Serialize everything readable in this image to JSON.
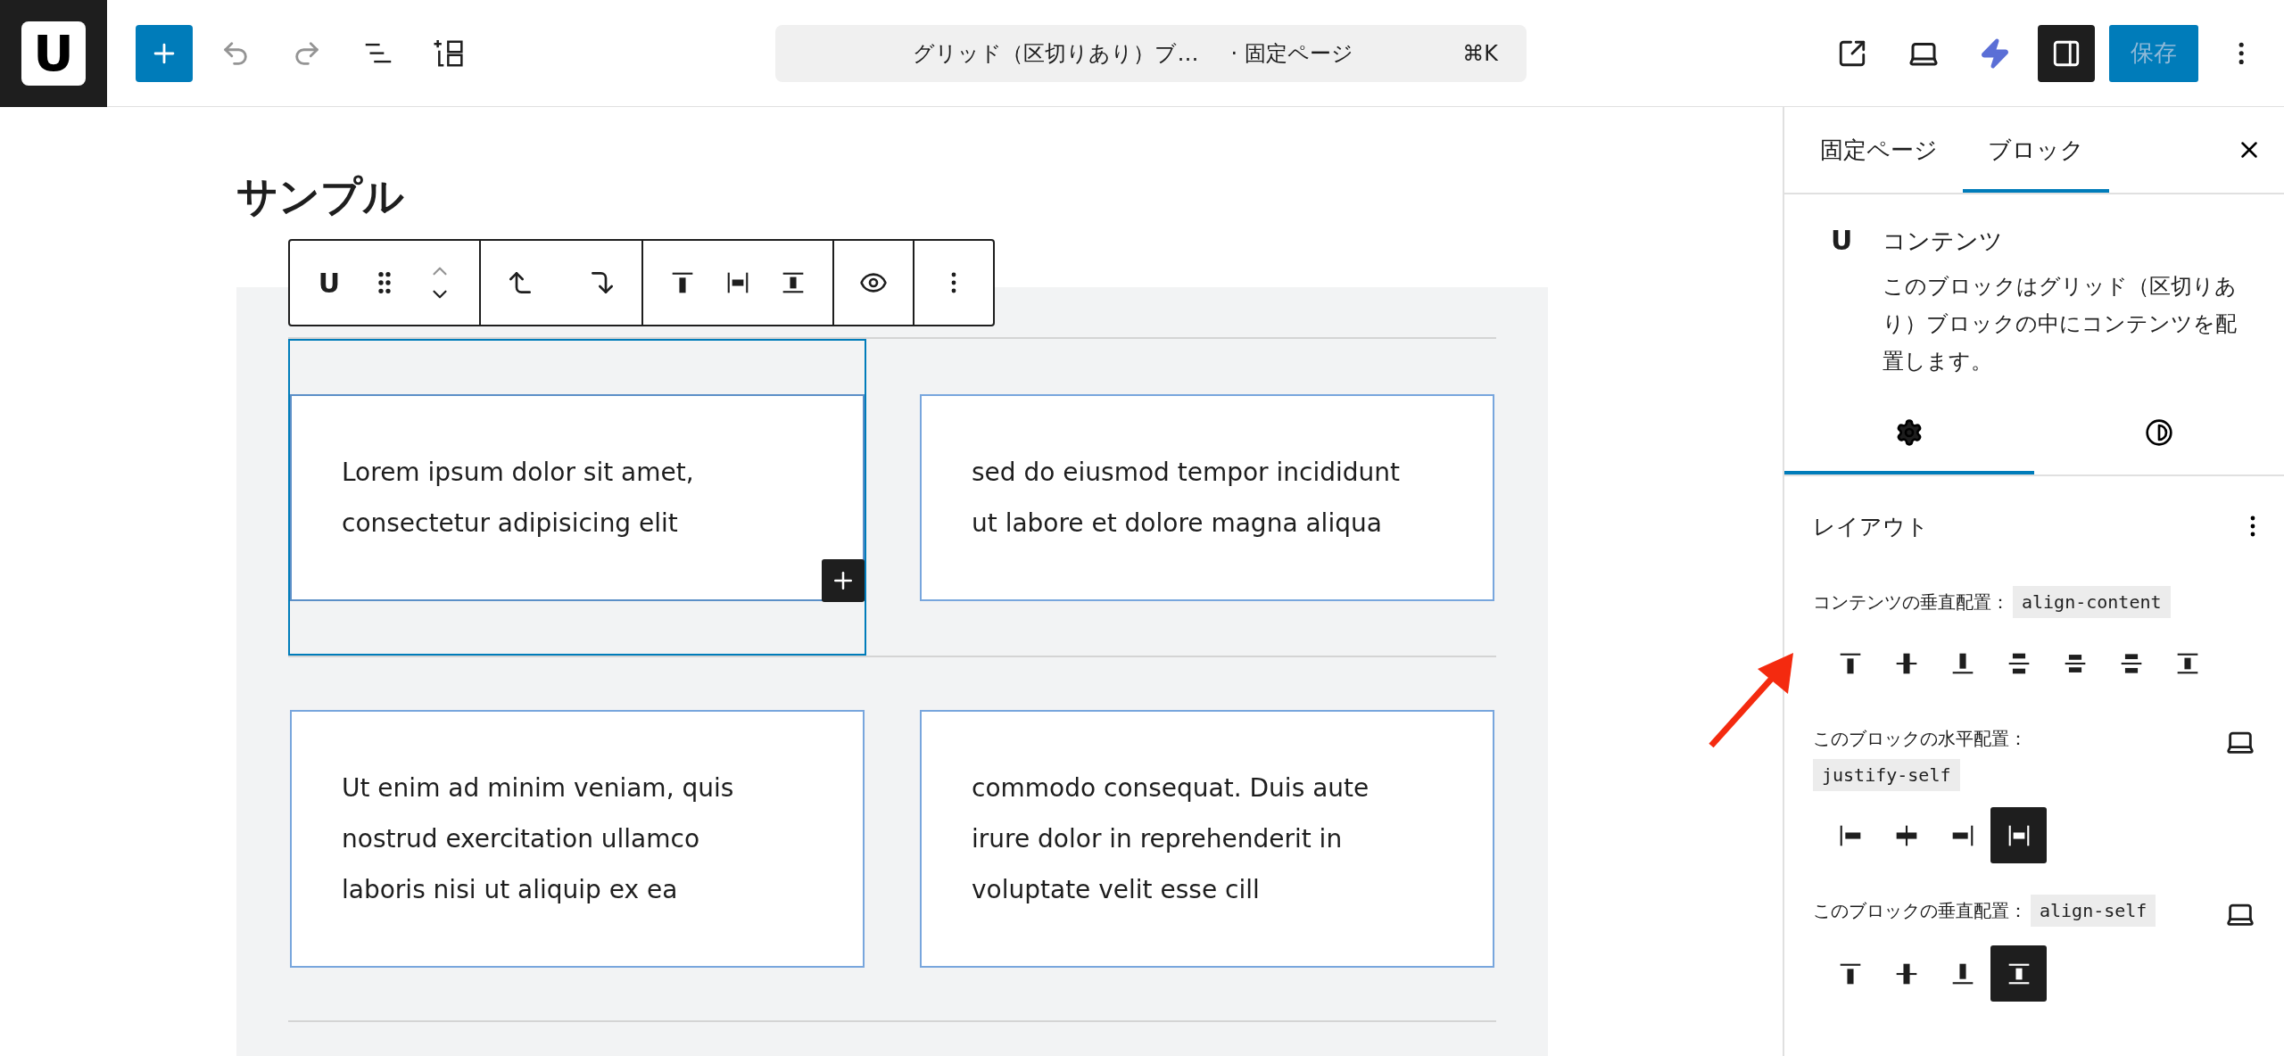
{
  "header": {
    "logo": "U",
    "undo_disabled": true,
    "redo_disabled": true,
    "command": {
      "title": "グリッド（区切りあり）ブ…",
      "type": "· 固定ページ",
      "shortcut": "⌘K"
    },
    "sidebar_open": true,
    "save": {
      "label": "保存",
      "disabled": true
    }
  },
  "canvas": {
    "title": "サンプル",
    "block_toolbar": {
      "block_icon": "U",
      "move_up_disabled": true
    },
    "cells": [
      {
        "lines": [
          "Lorem ipsum dolor sit amet,",
          "consectetur adipisicing elit"
        ],
        "selected": true
      },
      {
        "lines": [
          "sed do eiusmod tempor incididunt",
          "ut labore et dolore magna aliqua"
        ],
        "selected": false
      },
      {
        "lines": [
          "Ut enim ad minim veniam, quis",
          "nostrud exercitation ullamco",
          "laboris nisi ut aliquip ex ea"
        ],
        "selected": false
      },
      {
        "lines": [
          "commodo consequat. Duis aute",
          "irure dolor in reprehenderit in",
          "voluptate velit esse cill"
        ],
        "selected": false
      }
    ]
  },
  "sidebar": {
    "tabs": [
      {
        "label": "固定ページ",
        "selected": false
      },
      {
        "label": "ブロック",
        "selected": true
      }
    ],
    "block": {
      "icon": "U",
      "title": "コンテンツ",
      "description": "このブロックはグリッド（区切りあり）ブロックの中にコンテンツを配置します。"
    },
    "inspector_tabs": [
      {
        "kind": "settings",
        "selected": true
      },
      {
        "kind": "styles",
        "selected": false
      }
    ],
    "panel": {
      "title": "レイアウト",
      "controls": [
        {
          "label": "コンテンツの垂直配置：",
          "code": "align-content",
          "device": false,
          "options": [
            {
              "kind": "v-start",
              "selected": false
            },
            {
              "kind": "v-center",
              "selected": false
            },
            {
              "kind": "v-end",
              "selected": false
            },
            {
              "kind": "between",
              "selected": false
            },
            {
              "kind": "around",
              "selected": false
            },
            {
              "kind": "evenly",
              "selected": false
            },
            {
              "kind": "v-stretch",
              "selected": false
            }
          ]
        },
        {
          "label": "このブロックの水平配置：",
          "code": "justify-self",
          "device": true,
          "options": [
            {
              "kind": "h-start",
              "selected": false
            },
            {
              "kind": "h-center",
              "selected": false
            },
            {
              "kind": "h-end",
              "selected": false
            },
            {
              "kind": "h-stretch",
              "selected": true
            }
          ]
        },
        {
          "label": "このブロックの垂直配置：",
          "code": "align-self",
          "device": true,
          "options": [
            {
              "kind": "v-start",
              "selected": false
            },
            {
              "kind": "v-center",
              "selected": false
            },
            {
              "kind": "v-end",
              "selected": false
            },
            {
              "kind": "v-stretch",
              "selected": true
            }
          ]
        }
      ]
    }
  }
}
